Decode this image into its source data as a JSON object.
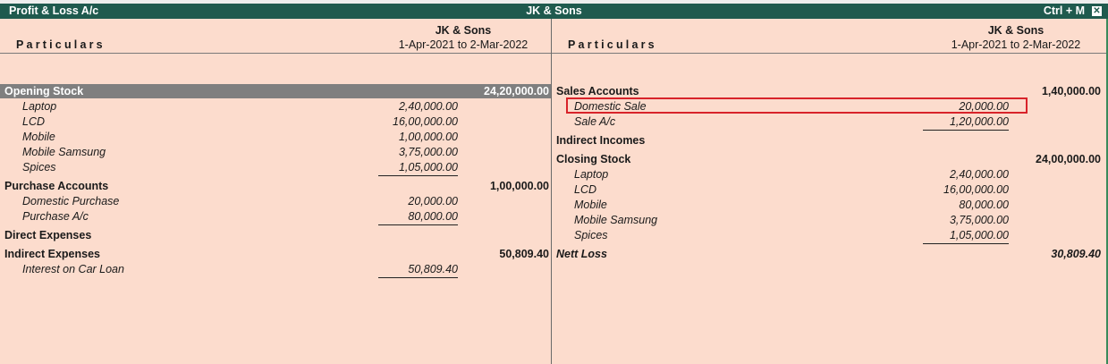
{
  "window": {
    "title_left": "Profit & Loss A/c",
    "title_center": "JK & Sons",
    "title_right": "Ctrl + M",
    "close_glyph": "✕"
  },
  "header": {
    "particulars": "Particulars",
    "company": "JK & Sons",
    "period": "1-Apr-2021 to 2-Mar-2022"
  },
  "left": {
    "opening_stock": {
      "label": "Opening Stock",
      "total": "24,20,000.00",
      "items": [
        {
          "label": "Laptop",
          "value": "2,40,000.00"
        },
        {
          "label": "LCD",
          "value": "16,00,000.00"
        },
        {
          "label": "Mobile",
          "value": "1,00,000.00"
        },
        {
          "label": "Mobile Samsung",
          "value": "3,75,000.00"
        },
        {
          "label": "Spices",
          "value": "1,05,000.00"
        }
      ]
    },
    "purchase": {
      "label": "Purchase Accounts",
      "total": "1,00,000.00",
      "items": [
        {
          "label": "Domestic Purchase",
          "value": "20,000.00"
        },
        {
          "label": "Purchase A/c",
          "value": "80,000.00"
        }
      ]
    },
    "direct_expenses": {
      "label": "Direct Expenses"
    },
    "indirect_expenses": {
      "label": "Indirect Expenses",
      "total": "50,809.40",
      "items": [
        {
          "label": "Interest on Car Loan",
          "value": "50,809.40"
        }
      ]
    }
  },
  "right": {
    "sales": {
      "label": "Sales Accounts",
      "total": "1,40,000.00",
      "items": [
        {
          "label": "Domestic Sale",
          "value": "20,000.00"
        },
        {
          "label": "Sale A/c",
          "value": "1,20,000.00"
        }
      ]
    },
    "indirect_incomes": {
      "label": "Indirect Incomes"
    },
    "closing_stock": {
      "label": "Closing Stock",
      "total": "24,00,000.00",
      "items": [
        {
          "label": "Laptop",
          "value": "2,40,000.00"
        },
        {
          "label": "LCD",
          "value": "16,00,000.00"
        },
        {
          "label": "Mobile",
          "value": "80,000.00"
        },
        {
          "label": "Mobile Samsung",
          "value": "3,75,000.00"
        },
        {
          "label": "Spices",
          "value": "1,05,000.00"
        }
      ]
    },
    "nett_loss": {
      "label": "Nett Loss",
      "value": "30,809.40"
    }
  },
  "colors": {
    "title_bar": "#1f5a4e",
    "background": "#fcdccd",
    "highlight_row": "#7f7f7f",
    "annotation_box": "#d8232a"
  }
}
